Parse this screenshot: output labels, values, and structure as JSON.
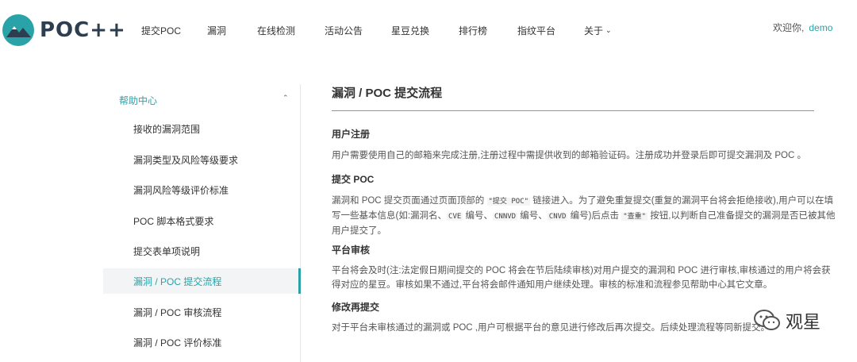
{
  "header": {
    "logo_text": "POC++",
    "nav": [
      {
        "label": "提交POC"
      },
      {
        "label": "漏洞"
      },
      {
        "label": "在线检测"
      },
      {
        "label": "活动公告"
      },
      {
        "label": "星豆兑换"
      },
      {
        "label": "排行榜"
      },
      {
        "label": "指纹平台"
      },
      {
        "label": "关于"
      }
    ],
    "welcome_text": "欢迎你,",
    "username": "demo",
    "colors": {
      "accent": "#2aa3a8",
      "logo": "#2c3e50"
    }
  },
  "sidebar": {
    "heading": "帮助中心",
    "items": [
      {
        "label": "接收的漏洞范围"
      },
      {
        "label": "漏洞类型及风险等级要求"
      },
      {
        "label": "漏洞风险等级评价标准"
      },
      {
        "label": "POC 脚本格式要求"
      },
      {
        "label": "提交表单项说明"
      },
      {
        "label": "漏洞 / POC 提交流程",
        "active": true
      },
      {
        "label": "漏洞 / POC 审核流程"
      },
      {
        "label": "漏洞 / POC 评价标准"
      }
    ]
  },
  "main": {
    "title": "漏洞 / POC 提交流程",
    "sections": [
      {
        "title": "用户注册",
        "body": "用户需要使用自己的邮箱来完成注册,注册过程中需提供收到的邮箱验证码。注册成功并登录后即可提交漏洞及 POC 。"
      },
      {
        "title": "提交 POC",
        "body_parts": [
          "漏洞和 POC 提交页面通过页面顶部的 ",
          "\"提交 POC\"",
          " 链接进入。为了避免重复提交(重复的漏洞平台将会拒绝接收),用户可以在填写一些基本信息(如:漏洞名、",
          "CVE",
          " 编号、",
          "CNNVD",
          " 编号、",
          "CNVD",
          " 编号)后点击 ",
          "\"查重\"",
          " 按钮,以判断自己准备提交的漏洞是否已被其他用户提交了。"
        ]
      },
      {
        "title": "平台审核",
        "body": "平台将会及时(注:法定假日期间提交的 POC 将会在节后陆续审核)对用户提交的漏洞和 POC 进行审核,审核通过的用户将会获得对应的星豆。审核如果不通过,平台将会邮件通知用户继续处理。审核的标准和流程参见帮助中心其它文章。"
      },
      {
        "title": "修改再提交",
        "body": "对于平台未审核通过的漏洞或 POC ,用户可根据平台的意见进行修改后再次提交。后续处理流程等同新提交。"
      }
    ]
  },
  "watermark": {
    "text": "观星"
  }
}
